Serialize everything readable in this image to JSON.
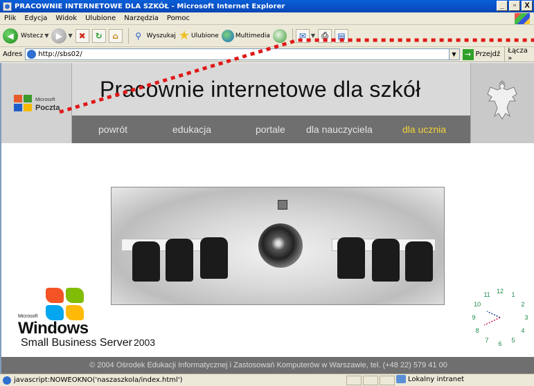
{
  "window": {
    "title": "PRACOWNIE INTERNETOWE DLA SZKÓŁ - Microsoft Internet Explorer",
    "controls": [
      "_",
      "▫",
      "X"
    ]
  },
  "menu": [
    "Plik",
    "Edycja",
    "Widok",
    "Ulubione",
    "Narzędzia",
    "Pomoc"
  ],
  "toolbar": {
    "back": "Wstecz",
    "search": "Wyszukaj",
    "favorites": "Ulubione",
    "multimedia": "Multimedia"
  },
  "address": {
    "label": "Adres",
    "url": "http://sbs02/",
    "go": "Przejdź",
    "links": "Łącza"
  },
  "site": {
    "logo_microsoft": "Microsoft",
    "logo_poczta": "Poczta",
    "title": "Pracownie internetowe dla szkół",
    "nav": [
      "powrót",
      "edukacja",
      "portale",
      "dla nauczyciela",
      "dla ucznia"
    ],
    "windows_ms": "Microsoft",
    "windows_word": "Windows",
    "sbs_product": "Small Business Server",
    "sbs_year": "2003",
    "footer": "© 2004 Ośrodek Edukacji Informatycznej i Zastosowań Komputerów w Warszawie, tel. (+48 22) 579 41 00"
  },
  "clock": {
    "numbers": [
      "12",
      "1",
      "2",
      "3",
      "4",
      "5",
      "6",
      "7",
      "8",
      "9",
      "10",
      "11"
    ],
    "color": "#1a8a4a"
  },
  "status": {
    "text": "javascript:NOWEOKNO('naszaszkola/index.html')",
    "zone": "Lokalny intranet"
  },
  "colors": {
    "title_bar": "#0a5fd8",
    "nav_active": "#f2d33a",
    "annotation": "#e01818"
  }
}
